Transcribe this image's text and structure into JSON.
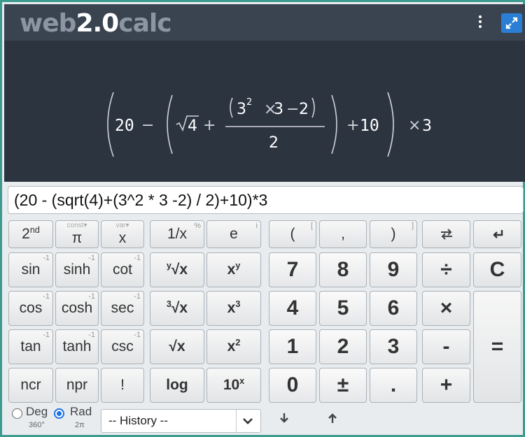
{
  "header": {
    "logo_web": "web",
    "logo_mid": "2.0",
    "logo_calc": "calc",
    "menu_icon": "kebab-menu-icon",
    "expand_icon": "expand-icon",
    "accent": "#2a7fd4"
  },
  "display": {
    "formula_a": "20",
    "formula_b": "4",
    "formula_c": "3",
    "formula_d": "2",
    "formula_e": "3",
    "formula_f": "2",
    "formula_g": "2",
    "formula_h": "10",
    "formula_i": "3"
  },
  "input": {
    "value": "(20 - (sqrt(4)+(3^2 * 3 -2) / 2)+10)*3"
  },
  "keys": {
    "second": "2nd",
    "second_sup": "nd",
    "pi": "π",
    "pi_top": "const",
    "x_var": "x",
    "x_top": "var",
    "inverse": "1/x",
    "inverse_corner": "%",
    "e": "e",
    "e_corner": "i",
    "open_paren": "(",
    "open_paren_corner": "[",
    "comma": ",",
    "close_paren": ")",
    "close_paren_corner": "]",
    "sin": "sin",
    "sinh": "sinh",
    "cot": "cot",
    "cos": "cos",
    "cosh": "cosh",
    "sec": "sec",
    "tan": "tan",
    "tanh": "tanh",
    "csc": "csc",
    "ncr": "ncr",
    "npr": "npr",
    "fact": "!",
    "inv_corner": "-1",
    "yroot": "√x",
    "yroot_pre": "y",
    "xpowy": "x",
    "xpowy_sup": "y",
    "cuberoot": "√x",
    "cuberoot_pre": "3",
    "xcube": "x",
    "xcube_sup": "3",
    "sqrt": "√x",
    "xsq": "x",
    "xsq_sup": "2",
    "log": "log",
    "tenpow": "10",
    "tenpow_sup": "x",
    "d7": "7",
    "d8": "8",
    "d9": "9",
    "d4": "4",
    "d5": "5",
    "d6": "6",
    "d1": "1",
    "d2": "2",
    "d3": "3",
    "d0": "0",
    "plusminus": "±",
    "dot": ".",
    "divide": "÷",
    "multiply": "×",
    "minus": "-",
    "plus": "+",
    "clear": "C",
    "equals": "="
  },
  "angle": {
    "deg_label": "Deg",
    "deg_sub": "360°",
    "rad_label": "Rad",
    "rad_sub": "2π",
    "selected": "Rad"
  },
  "history": {
    "value": "-- History --"
  }
}
